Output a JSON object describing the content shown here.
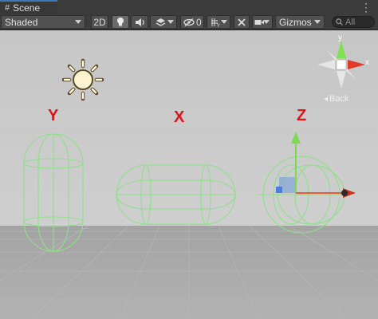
{
  "tab": {
    "icon": "grid-icon",
    "label": "Scene",
    "menu": "⋮"
  },
  "toolbar": {
    "shading_mode": "Shaded",
    "mode_2d": "2D",
    "fx_count": "0",
    "gizmos": "Gizmos",
    "search_placeholder": "All"
  },
  "scene": {
    "labels": {
      "y": "Y",
      "x": "X",
      "z": "Z"
    },
    "orientation_gizmo": {
      "y": "y",
      "x": "x",
      "back": "Back"
    }
  },
  "colors": {
    "panel": "#3c3c3c",
    "wireframe": "#8fe08a",
    "axis_label": "#e8101a",
    "sky": "#c9c9c9",
    "ground": "#a8a8a8"
  }
}
